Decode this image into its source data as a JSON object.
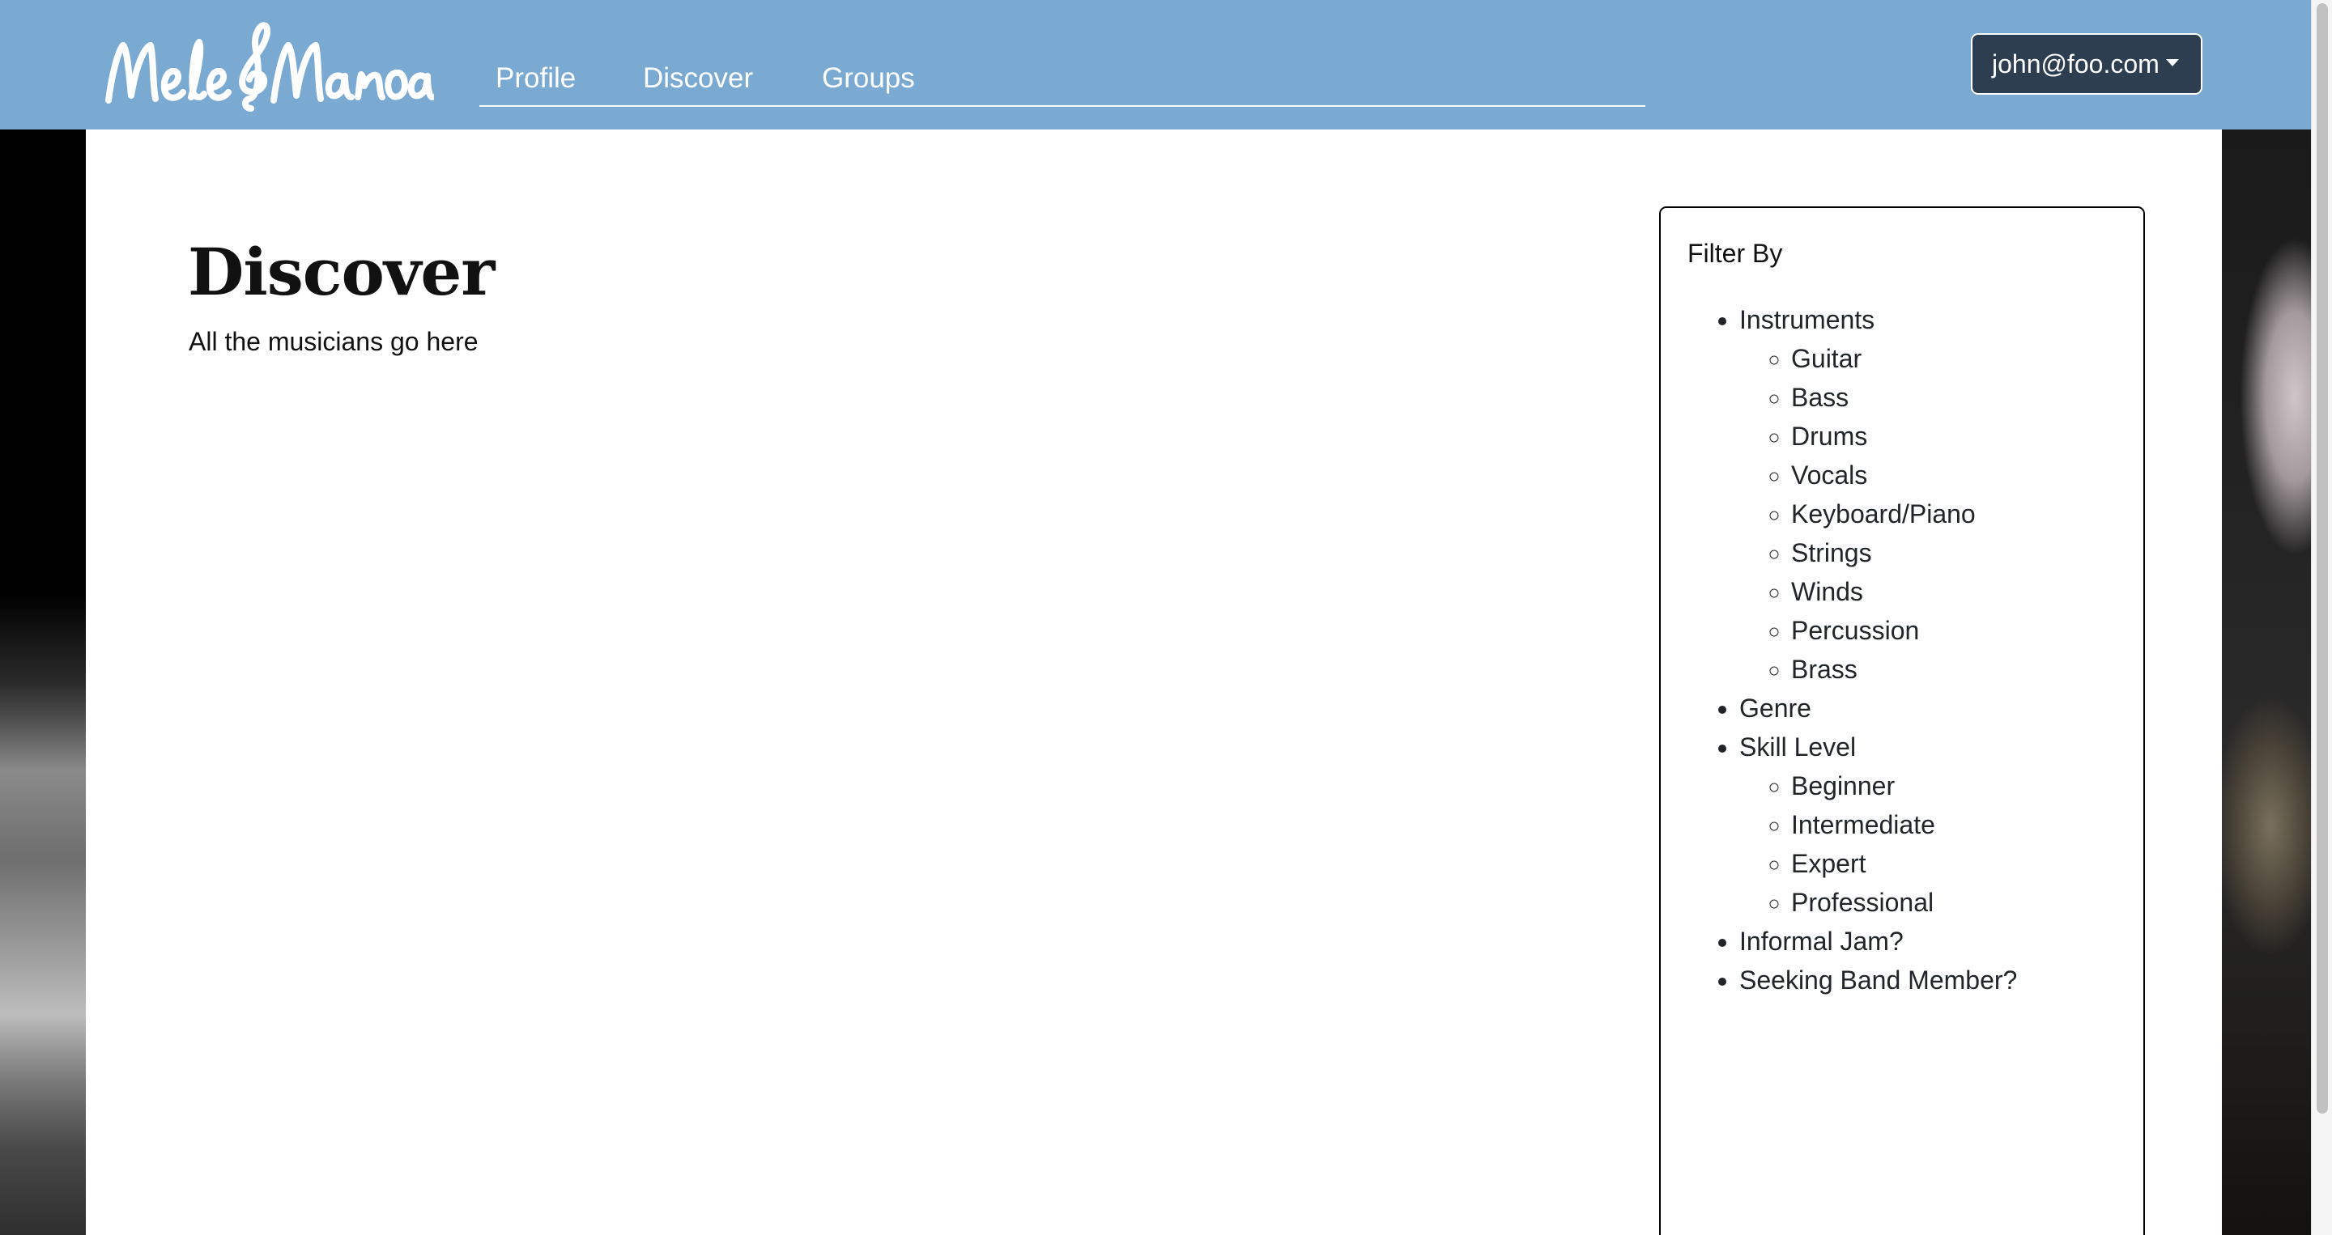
{
  "brand": {
    "name": "MeleManoa"
  },
  "nav": {
    "links": [
      {
        "label": "Profile"
      },
      {
        "label": "Discover"
      },
      {
        "label": "Groups"
      }
    ],
    "user_email": "john@foo.com"
  },
  "main": {
    "title": "Discover",
    "subtitle": "All the musicians go here"
  },
  "filter": {
    "title": "Filter By",
    "groups": [
      {
        "label": "Instruments",
        "items": [
          "Guitar",
          "Bass",
          "Drums",
          "Vocals",
          "Keyboard/Piano",
          "Strings",
          "Winds",
          "Percussion",
          "Brass"
        ]
      },
      {
        "label": "Genre",
        "items": []
      },
      {
        "label": "Skill Level",
        "items": [
          "Beginner",
          "Intermediate",
          "Expert",
          "Professional"
        ]
      },
      {
        "label": "Informal Jam?",
        "items": []
      },
      {
        "label": "Seeking Band Member?",
        "items": []
      }
    ]
  },
  "colors": {
    "navbar": "#7aaad1",
    "dropdown": "#2c3e50",
    "text": "#212529"
  },
  "icons": {
    "dropdown": "caret-down-icon",
    "logo": "treble-clef-logo"
  }
}
